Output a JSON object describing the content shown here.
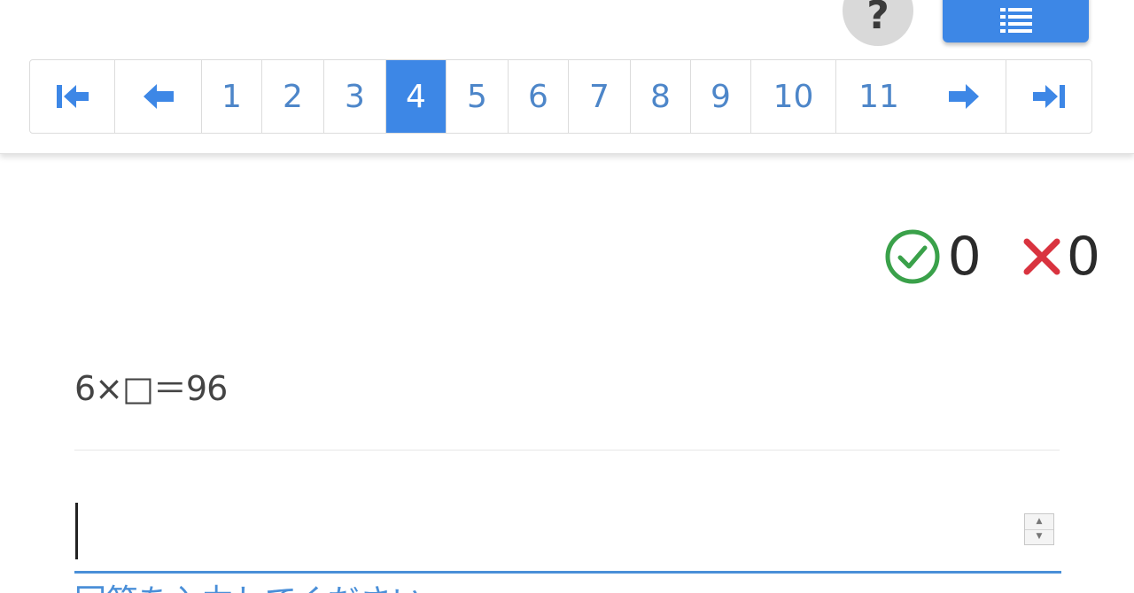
{
  "header": {
    "help_label": "?",
    "colors": {
      "accent": "#3d87e6",
      "link": "#4d86c9"
    }
  },
  "pagination": {
    "first_icon": "first-page-icon",
    "prev_icon": "arrow-left-icon",
    "next_icon": "arrow-right-icon",
    "last_icon": "last-page-icon",
    "pages": [
      "1",
      "2",
      "3",
      "4",
      "5",
      "6",
      "7",
      "8",
      "9",
      "10",
      "11"
    ],
    "current": "4"
  },
  "score": {
    "correct_icon": "check-circle-icon",
    "correct_count": "0",
    "wrong_icon": "cross-icon",
    "wrong_count": "0",
    "colors": {
      "correct": "#3aa14a",
      "wrong": "#d9333f"
    }
  },
  "question": {
    "text": "6×□＝96"
  },
  "answer": {
    "value": "",
    "hint": "回答を入力してください"
  }
}
